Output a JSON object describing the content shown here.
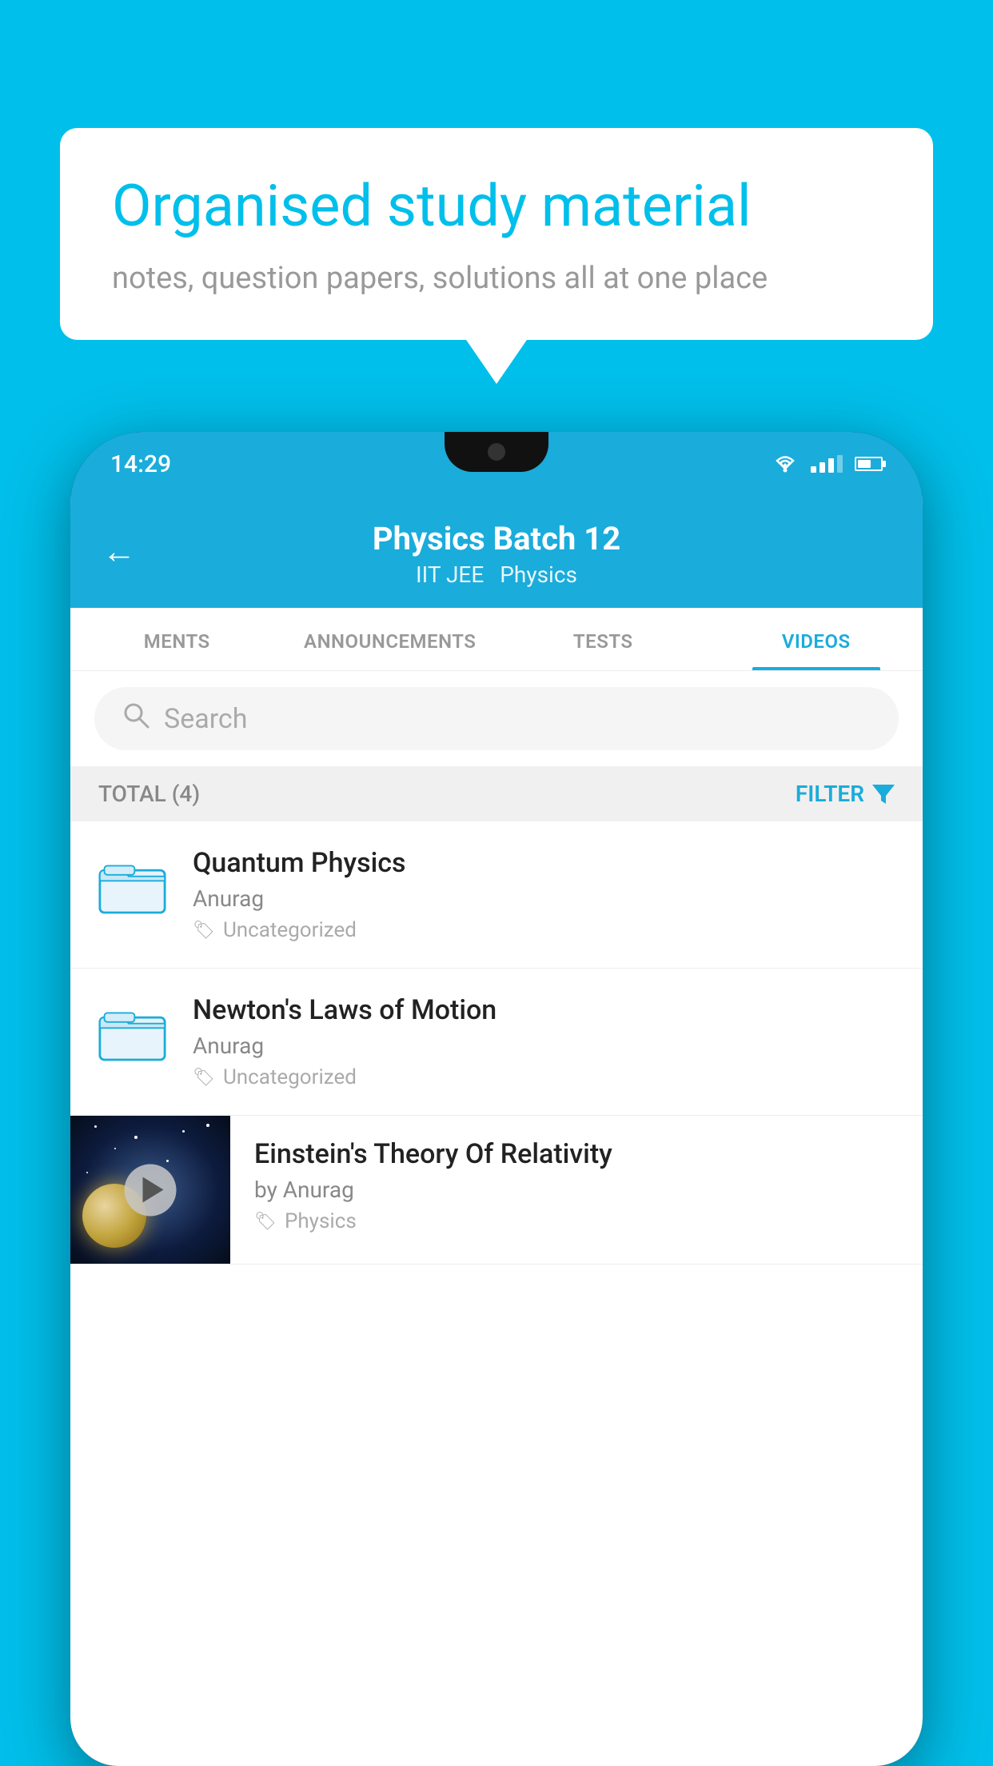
{
  "background_color": "#00BFEA",
  "speech_bubble": {
    "title": "Organised study material",
    "subtitle": "notes, question papers, solutions all at one place"
  },
  "status_bar": {
    "time": "14:29",
    "wifi": "wifi",
    "signal": "signal",
    "battery": "battery"
  },
  "header": {
    "back_label": "←",
    "title": "Physics Batch 12",
    "subtitle1": "IIT JEE",
    "subtitle2": "Physics"
  },
  "tabs": [
    {
      "label": "MENTS",
      "active": false
    },
    {
      "label": "ANNOUNCEMENTS",
      "active": false
    },
    {
      "label": "TESTS",
      "active": false
    },
    {
      "label": "VIDEOS",
      "active": true
    }
  ],
  "search": {
    "placeholder": "Search"
  },
  "filter_row": {
    "total_label": "TOTAL (4)",
    "filter_label": "FILTER"
  },
  "videos": [
    {
      "id": 1,
      "title": "Quantum Physics",
      "author": "Anurag",
      "tag": "Uncategorized",
      "type": "folder",
      "has_thumbnail": false
    },
    {
      "id": 2,
      "title": "Newton's Laws of Motion",
      "author": "Anurag",
      "tag": "Uncategorized",
      "type": "folder",
      "has_thumbnail": false
    },
    {
      "id": 3,
      "title": "Einstein's Theory Of Relativity",
      "author": "by Anurag",
      "tag": "Physics",
      "type": "video",
      "has_thumbnail": true
    }
  ],
  "accent_color": "#1AACDB",
  "tag_icon": "🏷"
}
